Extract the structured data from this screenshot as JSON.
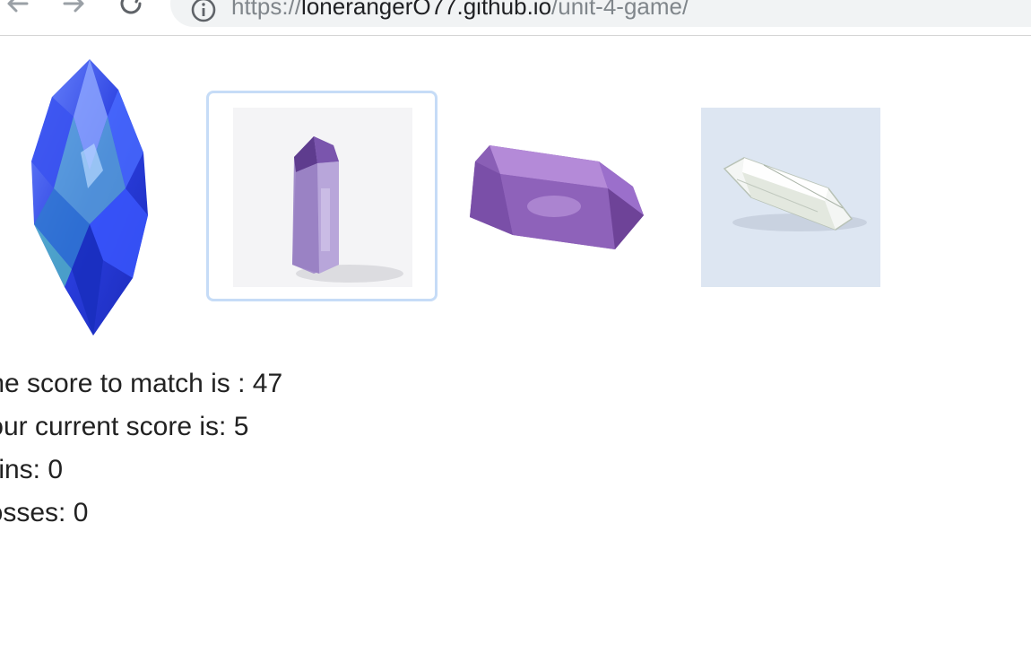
{
  "browser": {
    "url_scheme": "https://",
    "url_host": "lonerangerO77.github.io",
    "url_path": "/unit-4-game/",
    "icons": [
      "back-arrow-icon",
      "forward-arrow-icon",
      "reload-icon",
      "info-icon"
    ]
  },
  "crystals": [
    {
      "name": "blue-crystal",
      "color": "#2f4be0"
    },
    {
      "name": "amethyst-point-crystal",
      "color": "#8c6fb3",
      "selected": true
    },
    {
      "name": "amethyst-bar-crystal",
      "color": "#8a5fb6"
    },
    {
      "name": "clear-quartz-crystal",
      "color": "#dde6f2"
    }
  ],
  "score": {
    "target_label": "The score to match is : ",
    "target_value": "47",
    "current_label": "Your current score is: ",
    "current_value": "5",
    "wins_label": "Wins: ",
    "wins_value": "0",
    "losses_label": "Losses: ",
    "losses_value": "0"
  },
  "colors": {
    "selection_border": "#c6dcf7",
    "text": "#222222",
    "url_bar_bg": "#f1f3f4"
  }
}
